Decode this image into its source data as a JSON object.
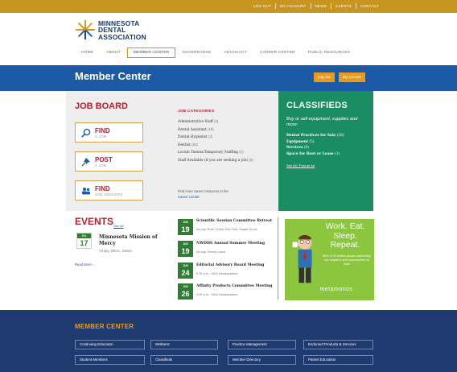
{
  "top_links": [
    "LOG OUT",
    "MY ACCOUNT",
    "NEWS",
    "EVENTS",
    "CONTACT"
  ],
  "logo": {
    "line1": "MINNESOTA",
    "line2": "DENTAL",
    "line3": "ASSOCIATION"
  },
  "nav": [
    "HOME",
    "ABOUT",
    "MEMBER CENTER",
    "GOVERNANCE",
    "ADVOCACY",
    "CAREER CENTER",
    "PUBLIC RESOURCES"
  ],
  "hero": {
    "title": "Member Center",
    "logout": "Log Out",
    "account": "My Account"
  },
  "job_board": {
    "title": "JOB BOARD",
    "actions": [
      {
        "big": "FIND",
        "small": "A JOB",
        "icon": "magnifier-icon"
      },
      {
        "big": "POST",
        "small": "A JOB",
        "icon": "pushpin-icon"
      },
      {
        "big": "FIND",
        "small": "JOB SEEKERS",
        "icon": "people-icon"
      }
    ],
    "categories_title": "JOB CATEGORIES",
    "categories": [
      {
        "name": "Administrative Staff",
        "count": "(4)"
      },
      {
        "name": "Dental Assistant",
        "count": "(18)"
      },
      {
        "name": "Dental Hygienist",
        "count": "(2)"
      },
      {
        "name": "Dentist",
        "count": "(64)"
      },
      {
        "name": "Locum Tenens/Temporary Staffing",
        "count": "(1)"
      },
      {
        "name": "Staff Available (if you are seeking a job)",
        "count": "(5)"
      }
    ],
    "note": "Find more career resources in the",
    "note_link": "Career Center."
  },
  "classifieds": {
    "title": "CLASSIFIEDS",
    "subtitle": "Buy or sell equipment, supplies and more:",
    "items": [
      {
        "name": "Dental Practices for Sale",
        "count": "(36)"
      },
      {
        "name": "Equipment",
        "count": "(5)"
      },
      {
        "name": "Services",
        "count": "(6)"
      },
      {
        "name": "Space for Rent or Lease",
        "count": "(1)"
      }
    ],
    "links": "See All / Post an Ad"
  },
  "events": {
    "title": "EVENTS",
    "see_all": "See All",
    "featured": {
      "month": "JUL",
      "day": "17",
      "title": "Minnesota Mission of Mercy",
      "meta": "All day, DECC, Duluth"
    },
    "read_more": "Read More ›",
    "list": [
      {
        "month": "JUN",
        "day": "19",
        "title": "Scientific Session Committee Retreat",
        "meta": "All day, Rush Creek Golf Club, Maple Grove"
      },
      {
        "month": "JUN",
        "day": "19",
        "title": "NWDDS Annual Summer Meeting",
        "meta": "All day, Detroit Lakes"
      },
      {
        "month": "JUN",
        "day": "24",
        "title": "Editorial Advisory Board Meeting",
        "meta": "5:30 p.m., MDA Headquarters"
      },
      {
        "month": "JUN",
        "day": "26",
        "title": "Affinity Products Committee Meeting",
        "meta": "2:00 p.m., MDA Headquarters"
      }
    ]
  },
  "ad": {
    "headline1": "Work. Eat.",
    "headline2": "Sleep.",
    "headline3": "Repeat.",
    "small": "56% of 10 million people admit they are negative and unproductive at work",
    "brand": "metamonos"
  },
  "footer": {
    "title": "MEMBER CENTER",
    "row1": [
      "Continuing Education",
      "Wellness",
      "Practice Management",
      "Endorsed Products & Services"
    ],
    "row2": [
      "Student Members",
      "Classifieds",
      "Member Directory",
      "Patient Education"
    ]
  },
  "colors": {
    "gold": "#c8951e",
    "blue": "#1d5aa5",
    "green": "#1a8e62",
    "red": "#b42030",
    "navy": "#1e3a6e",
    "orange": "#e89a1d",
    "lime": "#8cc63f"
  }
}
